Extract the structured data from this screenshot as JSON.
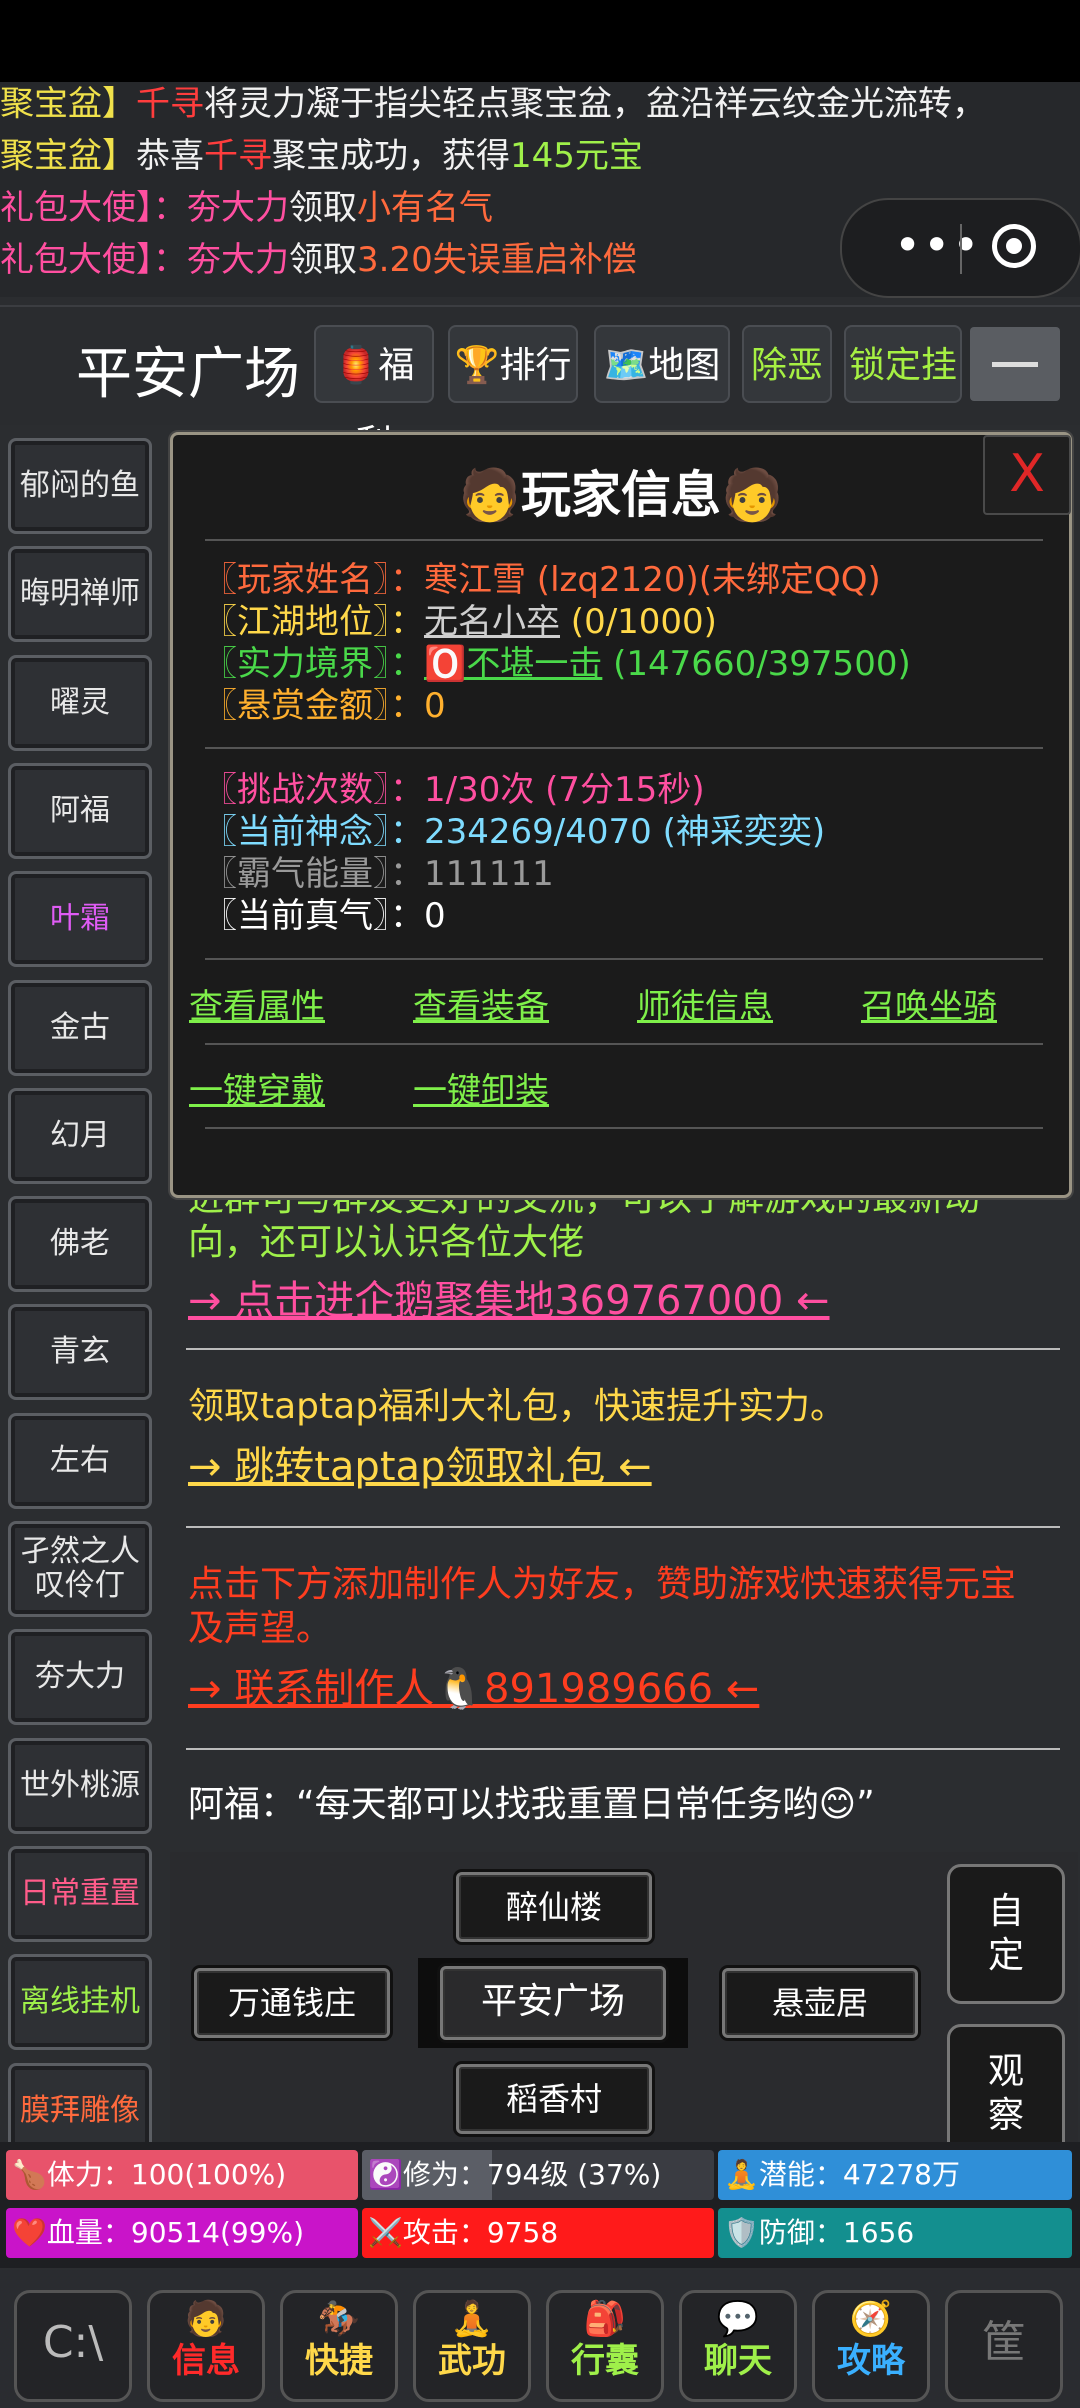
{
  "chat": [
    {
      "segments": [
        {
          "t": "聚宝盆】",
          "c": "yellow"
        },
        {
          "t": "千寻",
          "c": "red"
        },
        {
          "t": "将灵力凝于指尖轻点聚宝盆，盆沿祥云纹金光流转，",
          "c": "white"
        }
      ]
    },
    {
      "segments": [
        {
          "t": "聚宝盆】",
          "c": "yellow"
        },
        {
          "t": "恭喜",
          "c": "white"
        },
        {
          "t": "千寻",
          "c": "red"
        },
        {
          "t": "聚宝成功，获得",
          "c": "white"
        },
        {
          "t": "145元宝",
          "c": "green"
        }
      ]
    },
    {
      "segments": [
        {
          "t": "礼包大使】：",
          "c": "pink"
        },
        {
          "t": "夯大力",
          "c": "pink"
        },
        {
          "t": "领取",
          "c": "white"
        },
        {
          "t": "小有名气",
          "c": "orange"
        }
      ]
    },
    {
      "segments": [
        {
          "t": "礼包大使】：",
          "c": "pink"
        },
        {
          "t": "夯大力",
          "c": "pink"
        },
        {
          "t": "领取",
          "c": "white"
        },
        {
          "t": "3.20失误重启补偿",
          "c": "orange"
        }
      ]
    }
  ],
  "header": {
    "title": "平安广场",
    "buttons": [
      {
        "label": "🏮福利",
        "style": "white"
      },
      {
        "label": "🏆排行",
        "style": "white"
      },
      {
        "label": "🗺️地图",
        "style": "white"
      },
      {
        "label": "除恶",
        "style": "green"
      },
      {
        "label": "锁定挂",
        "style": "green"
      }
    ]
  },
  "npcs": [
    {
      "label": "郁闷的鱼",
      "color": "#e8e8e8"
    },
    {
      "label": "晦明禅师",
      "color": "#e8e8e8"
    },
    {
      "label": "曜灵",
      "color": "#e8e8e8"
    },
    {
      "label": "阿福",
      "color": "#e8e8e8"
    },
    {
      "label": "叶霜",
      "color": "#e05cf5"
    },
    {
      "label": "金古",
      "color": "#e8e8e8"
    },
    {
      "label": "幻月",
      "color": "#e8e8e8"
    },
    {
      "label": "佛老",
      "color": "#e8e8e8"
    },
    {
      "label": "青玄",
      "color": "#e8e8e8"
    },
    {
      "label": "左右",
      "color": "#e8e8e8"
    },
    {
      "label": "孑然之人\n叹伶仃",
      "color": "#e8e8e8"
    },
    {
      "label": "夯大力",
      "color": "#e8e8e8"
    },
    {
      "label": "世外桃源",
      "color": "#e8e8e8"
    },
    {
      "label": "日常重置",
      "color": "#ff5c8a"
    },
    {
      "label": "离线挂机",
      "color": "#9ff04a"
    },
    {
      "label": "膜拜雕像",
      "color": "#ff6a3d"
    }
  ],
  "main": {
    "partial_text_1": "进群可与群友更好的交流，可以了解游戏的最新动",
    "partial_text_2": "向，还可以认识各位大佬",
    "qq_link": "→ 点击进企鹅聚集地369767000 ←",
    "taptap_text": "领取taptap福利大礼包，快速提升实力。",
    "taptap_link": "→ 跳转taptap领取礼包 ←",
    "sponsor_text_1": "点击下方添加制作人为好友，赞助游戏快速获得元宝",
    "sponsor_text_2": "及声望。",
    "sponsor_link": "→ 联系制作人🐧891989666 ←",
    "npc_quote": "阿福：“每天都可以找我重置日常任务哟😊”"
  },
  "popup": {
    "title": "🧑玩家信息🧑",
    "close": "X",
    "rows": [
      {
        "label": "〖玩家姓名〗：",
        "label_color": "#ff6a3d",
        "value": "寒江雪 (lzq2120)(未绑定QQ)",
        "value_color": "#ff6a3d"
      },
      {
        "label": "〖江湖地位〗：",
        "label_color": "#ffd84a",
        "value_u": "无名小卒",
        "value_u_color": "#cfcfcf",
        "value": " (0/1000)",
        "value_color": "#ffd84a"
      },
      {
        "label": "〖实力境界〗：",
        "label_color": "#4ad94a",
        "value_u": "🅾️不堪一击",
        "value_u_color": "#4ad94a",
        "value": " (147660/397500)",
        "value_color": "#4ad94a"
      },
      {
        "label": "〖悬赏金额〗：",
        "label_color": "#ffb02e",
        "value": "0",
        "value_color": "#ffb02e"
      },
      {
        "label": "〖挑战次数〗：",
        "label_color": "#ff4fa0",
        "value": "1/30次 (7分15秒)",
        "value_color": "#ff4fa0"
      },
      {
        "label": "〖当前神念〗：",
        "label_color": "#7fdcff",
        "value": "234269/4070 (神采奕奕)",
        "value_color": "#7fdcff"
      },
      {
        "label": "〖霸气能量〗：",
        "label_color": "#9a9a9a",
        "value": "111111",
        "value_color": "#9a9a9a"
      },
      {
        "label": "〖当前真气〗：",
        "label_color": "#ffffff",
        "value": "0",
        "value_color": "#ffffff"
      }
    ],
    "links_row1": [
      "查看属性",
      "查看装备",
      "师徒信息",
      "召唤坐骑"
    ],
    "links_row2": [
      "一键穿戴",
      "一键卸装"
    ]
  },
  "locations": {
    "north": "醉仙楼",
    "west": "万通钱庄",
    "center": "平安广场",
    "east": "悬壶居",
    "south": "稻香村",
    "custom": "自\n定",
    "observe": "观\n察"
  },
  "stats": {
    "stamina": {
      "label": "体力：100(100%)",
      "icon": "🍗",
      "color": "#e8536b"
    },
    "cultivation": {
      "label": "修为：794级 (37%)",
      "icon": "☯️",
      "color": "#5b5e66",
      "progress": 0.37
    },
    "potential": {
      "label": "潜能：47278万",
      "icon": "🧘",
      "color": "#2f8fd8"
    },
    "hp": {
      "label": "血量：90514(99%)",
      "icon": "❤️",
      "color": "#c914c9"
    },
    "attack": {
      "label": "攻击：9758",
      "icon": "⚔️",
      "color": "#ff1a1a"
    },
    "defense": {
      "label": "防御：1656",
      "icon": "🛡️",
      "color": "#138f8f"
    }
  },
  "nav": [
    {
      "label": "",
      "icon": "C:\\",
      "color": "#bbbbbb"
    },
    {
      "label": "信息",
      "icon": "🧑",
      "color": "#ff2a2a"
    },
    {
      "label": "快捷",
      "icon": "🏇",
      "color": "#ffd84a"
    },
    {
      "label": "武功",
      "icon": "🧘",
      "color": "#ffd84a"
    },
    {
      "label": "行囊",
      "icon": "🎒",
      "color": "#9ff04a"
    },
    {
      "label": "聊天",
      "icon": "💬",
      "color": "#9ff04a"
    },
    {
      "label": "攻略",
      "icon": "🧭",
      "color": "#3ab0ff"
    },
    {
      "label": "",
      "icon": "筐",
      "color": "#777777"
    }
  ]
}
